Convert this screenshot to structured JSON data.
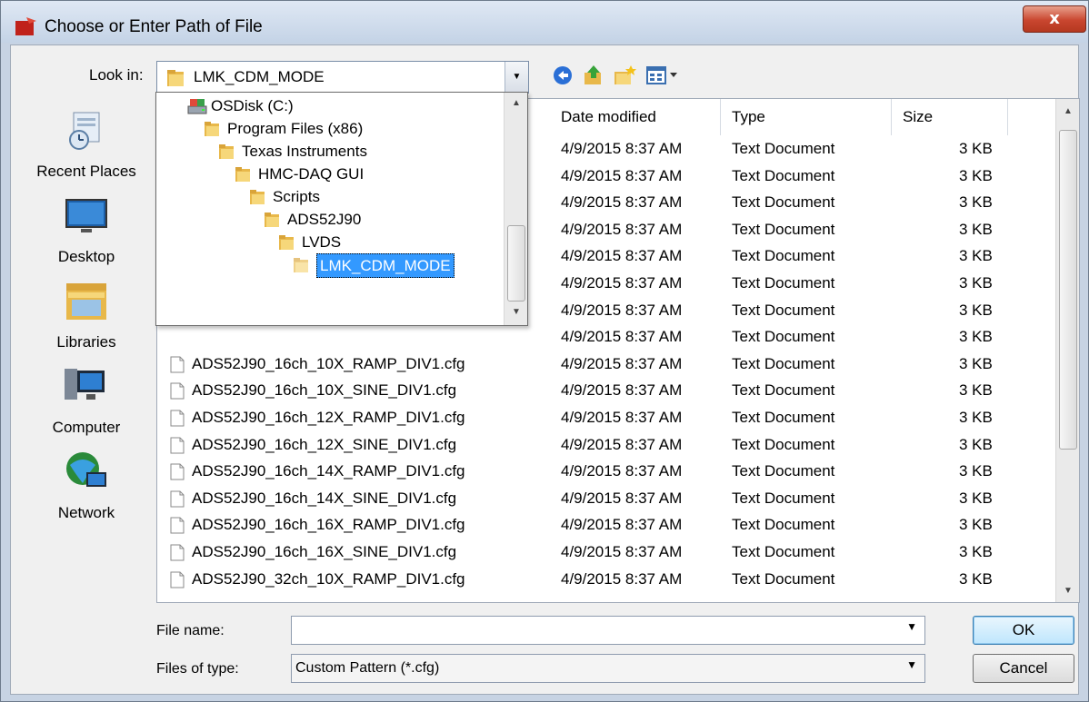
{
  "window": {
    "title": "Choose or Enter Path of File",
    "close_label": "x"
  },
  "lookin": {
    "label": "Look in:",
    "value": "LMK_CDM_MODE"
  },
  "toolbar": {
    "icons": [
      "back-icon",
      "up-folder-icon",
      "new-folder-icon",
      "view-menu-icon"
    ]
  },
  "places": [
    {
      "label": "Recent Places",
      "icon": "recent-places-icon"
    },
    {
      "label": "Desktop",
      "icon": "desktop-icon"
    },
    {
      "label": "Libraries",
      "icon": "libraries-icon"
    },
    {
      "label": "Computer",
      "icon": "computer-icon"
    },
    {
      "label": "Network",
      "icon": "network-icon"
    }
  ],
  "dropdown": {
    "items": [
      {
        "label": "OSDisk (C:)",
        "icon": "drive-icon"
      },
      {
        "label": "Program Files (x86)",
        "icon": "folder-icon"
      },
      {
        "label": "Texas Instruments",
        "icon": "folder-icon"
      },
      {
        "label": "HMC-DAQ GUI",
        "icon": "folder-icon"
      },
      {
        "label": "Scripts",
        "icon": "folder-icon"
      },
      {
        "label": "ADS52J90",
        "icon": "folder-icon"
      },
      {
        "label": "LVDS",
        "icon": "folder-icon"
      },
      {
        "label": "LMK_CDM_MODE",
        "icon": "folder-icon",
        "selected": true
      }
    ]
  },
  "filelist": {
    "columns": [
      "Date modified",
      "Type",
      "Size"
    ],
    "rows": [
      {
        "name": "",
        "date": "4/9/2015 8:37 AM",
        "type": "Text Document",
        "size": "3 KB"
      },
      {
        "name": "",
        "date": "4/9/2015 8:37 AM",
        "type": "Text Document",
        "size": "3 KB"
      },
      {
        "name": "",
        "date": "4/9/2015 8:37 AM",
        "type": "Text Document",
        "size": "3 KB"
      },
      {
        "name": "",
        "date": "4/9/2015 8:37 AM",
        "type": "Text Document",
        "size": "3 KB"
      },
      {
        "name": "",
        "date": "4/9/2015 8:37 AM",
        "type": "Text Document",
        "size": "3 KB"
      },
      {
        "name": "",
        "date": "4/9/2015 8:37 AM",
        "type": "Text Document",
        "size": "3 KB"
      },
      {
        "name": "",
        "date": "4/9/2015 8:37 AM",
        "type": "Text Document",
        "size": "3 KB"
      },
      {
        "name": "",
        "date": "4/9/2015 8:37 AM",
        "type": "Text Document",
        "size": "3 KB"
      },
      {
        "name": "ADS52J90_16ch_10X_RAMP_DIV1.cfg",
        "date": "4/9/2015 8:37 AM",
        "type": "Text Document",
        "size": "3 KB"
      },
      {
        "name": "ADS52J90_16ch_10X_SINE_DIV1.cfg",
        "date": "4/9/2015 8:37 AM",
        "type": "Text Document",
        "size": "3 KB"
      },
      {
        "name": "ADS52J90_16ch_12X_RAMP_DIV1.cfg",
        "date": "4/9/2015 8:37 AM",
        "type": "Text Document",
        "size": "3 KB"
      },
      {
        "name": "ADS52J90_16ch_12X_SINE_DIV1.cfg",
        "date": "4/9/2015 8:37 AM",
        "type": "Text Document",
        "size": "3 KB"
      },
      {
        "name": "ADS52J90_16ch_14X_RAMP_DIV1.cfg",
        "date": "4/9/2015 8:37 AM",
        "type": "Text Document",
        "size": "3 KB"
      },
      {
        "name": "ADS52J90_16ch_14X_SINE_DIV1.cfg",
        "date": "4/9/2015 8:37 AM",
        "type": "Text Document",
        "size": "3 KB"
      },
      {
        "name": "ADS52J90_16ch_16X_RAMP_DIV1.cfg",
        "date": "4/9/2015 8:37 AM",
        "type": "Text Document",
        "size": "3 KB"
      },
      {
        "name": "ADS52J90_16ch_16X_SINE_DIV1.cfg",
        "date": "4/9/2015 8:37 AM",
        "type": "Text Document",
        "size": "3 KB"
      },
      {
        "name": "ADS52J90_32ch_10X_RAMP_DIV1.cfg",
        "date": "4/9/2015 8:37 AM",
        "type": "Text Document",
        "size": "3 KB"
      }
    ]
  },
  "bottom": {
    "filename_label": "File name:",
    "filename_value": "",
    "filetype_label": "Files of type:",
    "filetype_value": "Custom Pattern (*.cfg)",
    "ok_label": "OK",
    "cancel_label": "Cancel"
  }
}
